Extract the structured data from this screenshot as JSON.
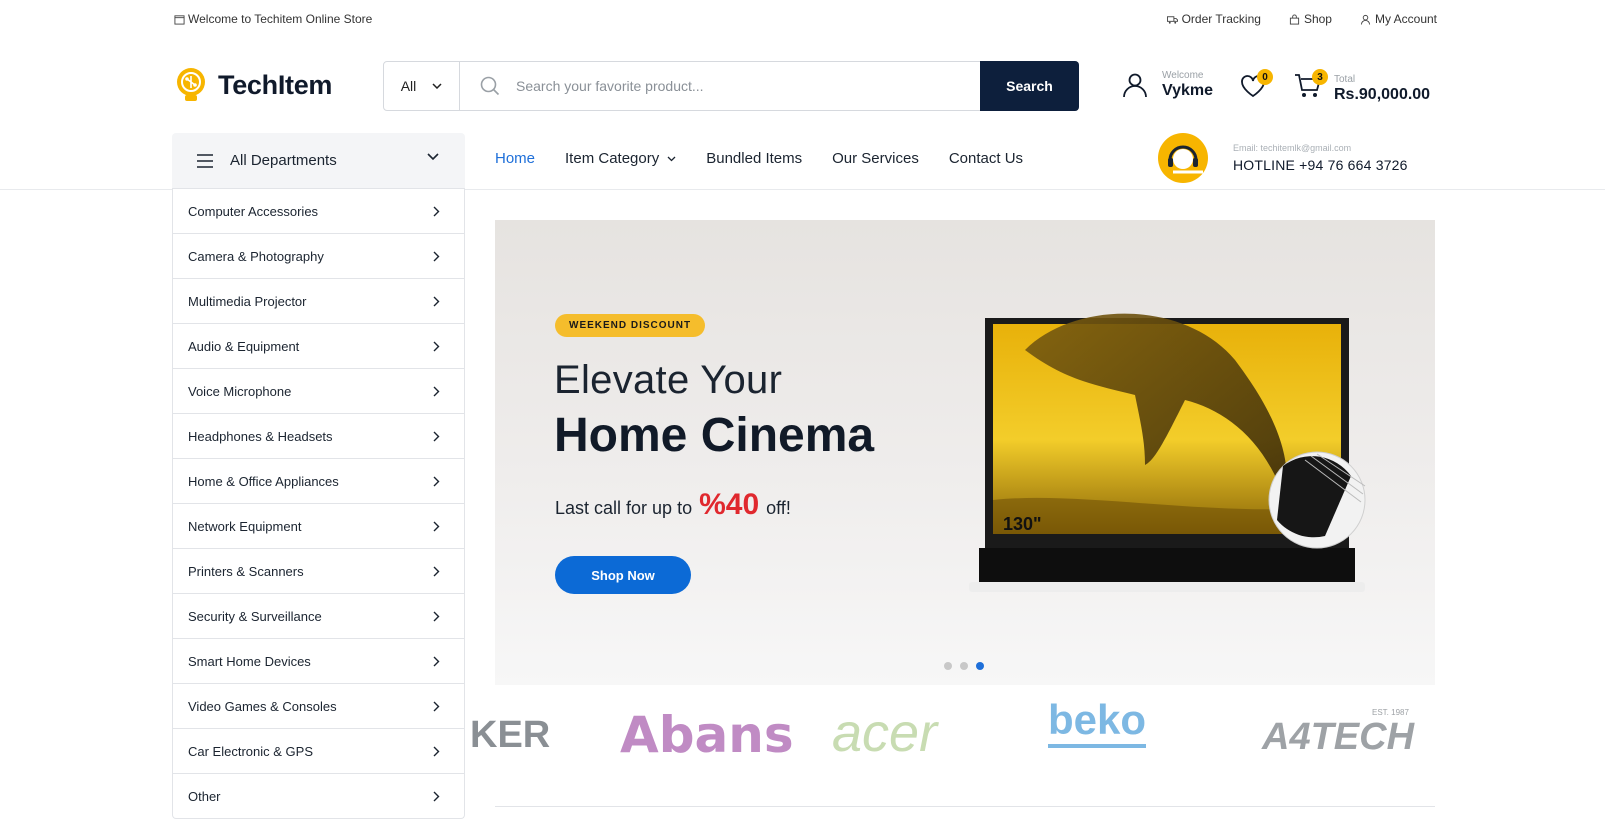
{
  "topbar": {
    "welcome": "Welcome to Techitem Online Store",
    "links": [
      {
        "label": "Order Tracking",
        "icon": "truck-icon"
      },
      {
        "label": "Shop",
        "icon": "bag-icon"
      },
      {
        "label": "My Account",
        "icon": "user-icon"
      }
    ]
  },
  "header": {
    "logo_text": "TechItem",
    "search": {
      "category": "All",
      "placeholder": "Search your favorite product...",
      "button": "Search"
    },
    "account": {
      "small": "Welcome",
      "name": "Vykme"
    },
    "wishlist_count": "0",
    "cart": {
      "count": "3",
      "small": "Total",
      "total": "Rs.90,000.00"
    }
  },
  "nav": {
    "departments_label": "All Departments",
    "items": [
      {
        "label": "Home",
        "active": true
      },
      {
        "label": "Item Category",
        "dropdown": true
      },
      {
        "label": "Bundled Items"
      },
      {
        "label": "Our Services"
      },
      {
        "label": "Contact Us"
      }
    ],
    "hotline": {
      "email": "Email: techitemlk@gmail.com",
      "phone": "HOTLINE +94 76 664 3726"
    }
  },
  "departments": [
    "Computer Accessories",
    "Camera & Photography",
    "Multimedia Projector",
    "Audio & Equipment",
    "Voice Microphone",
    "Headphones & Headsets",
    "Home & Office Appliances",
    "Network Equipment",
    "Printers & Scanners",
    "Security & Surveillance",
    "Smart Home Devices",
    "Video Games & Consoles",
    "Car Electronic & GPS",
    "Other"
  ],
  "hero": {
    "tag": "WEEKEND DISCOUNT",
    "title_line1": "Elevate Your",
    "title_line2": "Home Cinema",
    "offer_prefix": "Last call for up to",
    "offer_value": "%40",
    "offer_suffix": "off!",
    "button": "Shop Now",
    "screen_label": "130\"",
    "slide_active": 3,
    "slide_count": 3
  },
  "brands": [
    "KER",
    "Abans",
    "acer",
    "beko",
    "A4TECH"
  ],
  "brand_extra": "EST. 1987",
  "colors": {
    "accent": "#1e6fd9",
    "navy": "#0d1f3c",
    "yellow": "#f7b500",
    "offer_red": "#e0282e"
  }
}
